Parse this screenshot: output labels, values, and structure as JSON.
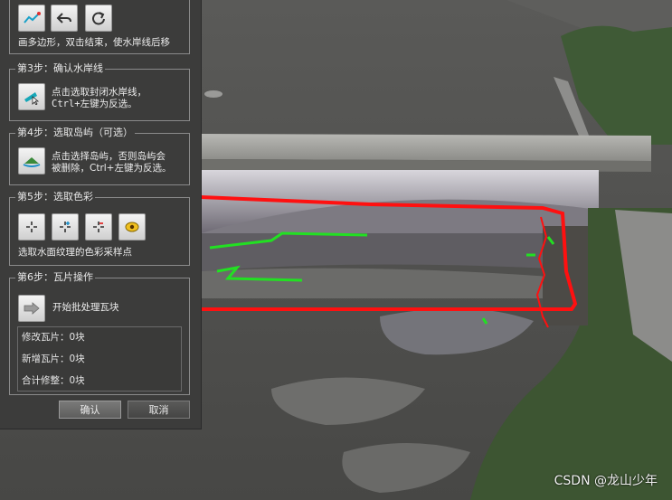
{
  "step2": {
    "hint": "画多边形，双击结束，使水岸线后移"
  },
  "step3": {
    "title": "第3步：确认水岸线",
    "desc_line1": "点击选取封闭水岸线，",
    "desc_line2": "Ctrl+左键为反选。"
  },
  "step4": {
    "title": "第4步：选取岛屿（可选）",
    "desc_line1": "点击选择岛屿，否则岛屿会",
    "desc_line2": "被删除，Ctrl+左键为反选。"
  },
  "step5": {
    "title": "第5步：选取色彩",
    "desc": "选取水面纹理的色彩采样点"
  },
  "step6": {
    "title": "第6步：瓦片操作",
    "action_label": "开始批处理瓦块",
    "stats": [
      "修改瓦片：0块",
      "新增瓦片：0块",
      "合计修整：0块"
    ]
  },
  "buttons": {
    "confirm": "确认",
    "cancel": "取消"
  },
  "watermark": "CSDN @龙山少年",
  "colors": {
    "boundary_red": "#ff1010",
    "waterline_green": "#22e022",
    "panel_bg": "#3c3c3b"
  }
}
